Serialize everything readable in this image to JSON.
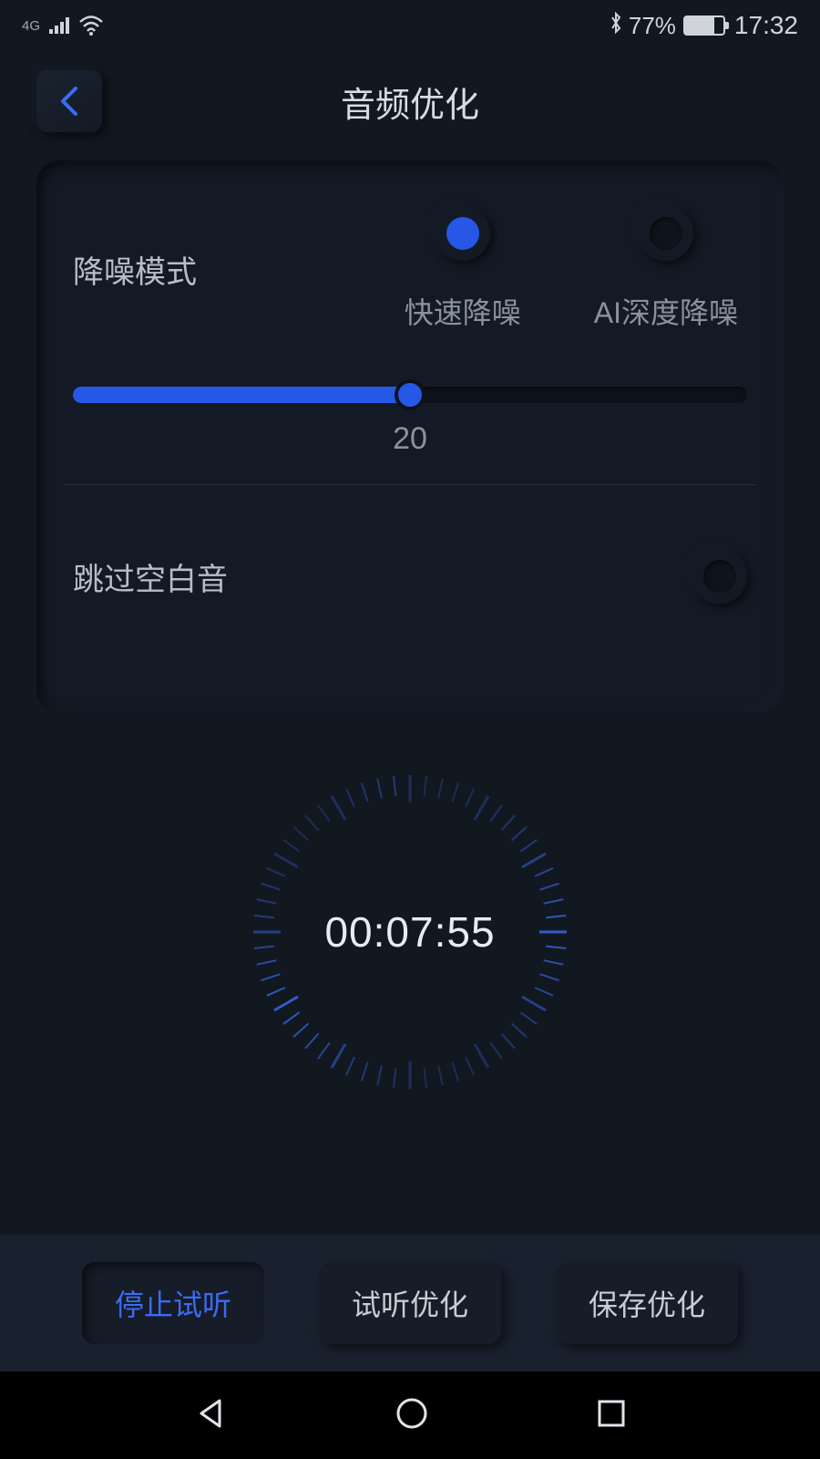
{
  "status": {
    "network_label": "4G",
    "battery_pct": "77%",
    "time": "17:32"
  },
  "header": {
    "title": "音频优化"
  },
  "card": {
    "noise_mode_label": "降噪模式",
    "radio_options": {
      "fast": "快速降噪",
      "ai": "AI深度降噪"
    },
    "slider_value": "20",
    "skip_silence_label": "跳过空白音"
  },
  "timer": {
    "value": "00:07:55"
  },
  "buttons": {
    "stop_preview": "停止试听",
    "preview_opt": "试听优化",
    "save_opt": "保存优化"
  }
}
